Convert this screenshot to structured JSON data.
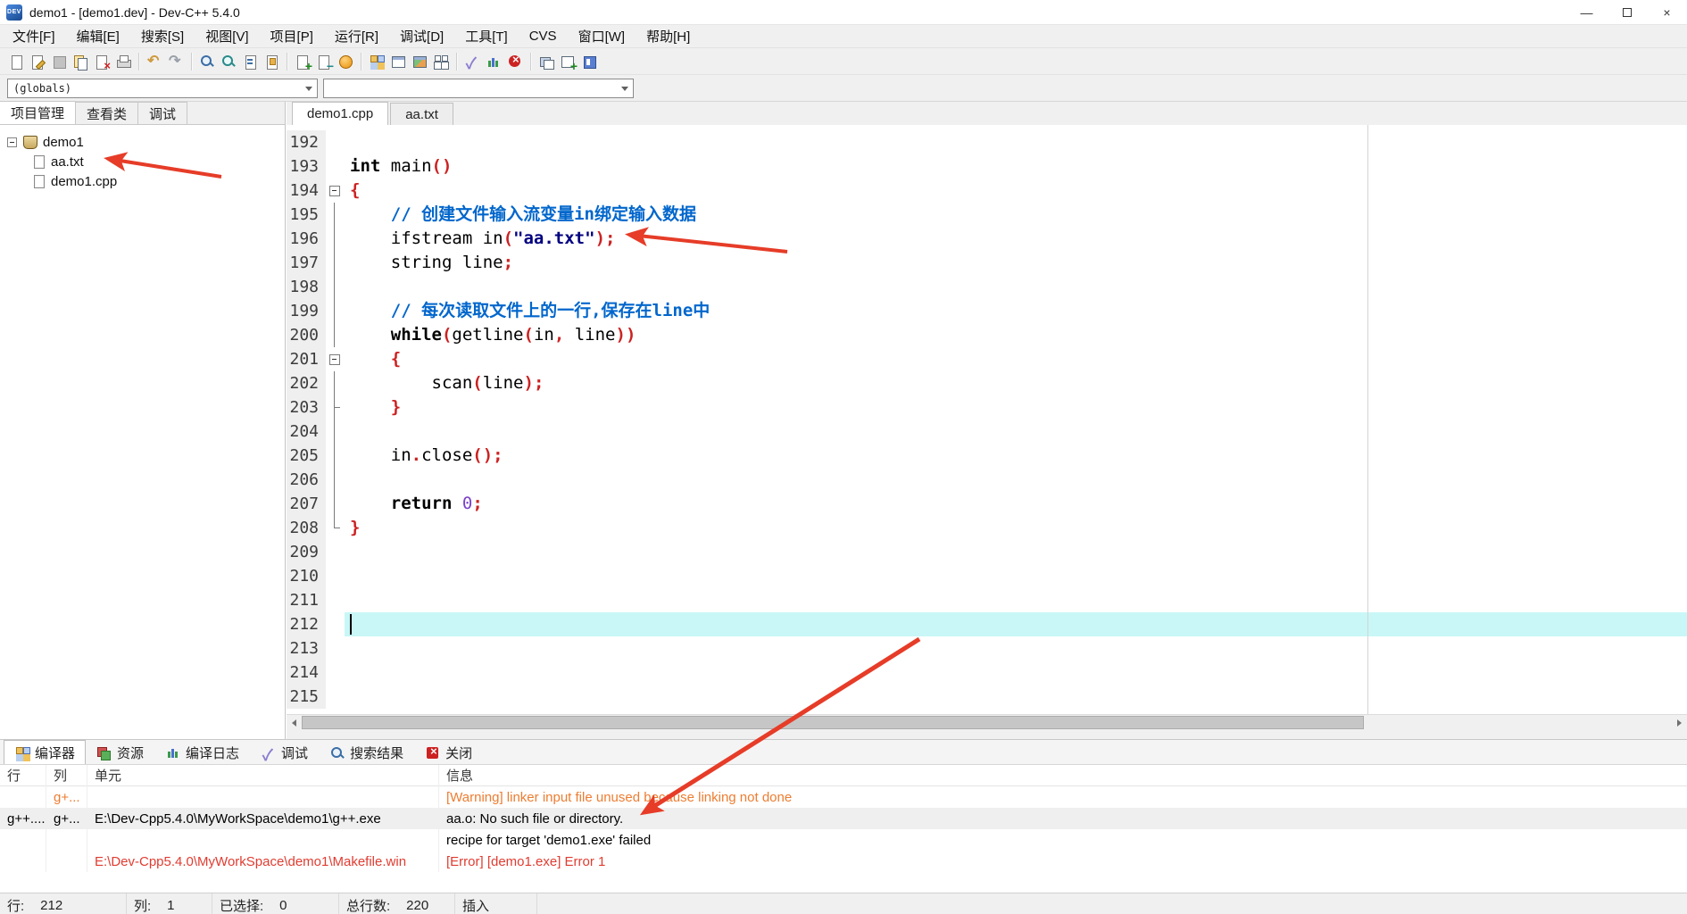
{
  "window": {
    "title": "demo1 - [demo1.dev] - Dev-C++ 5.4.0",
    "app_icon_label": "DEV",
    "controls": {
      "minimize": "—",
      "restore": "",
      "close": "×"
    }
  },
  "menu": {
    "items": [
      "文件[F]",
      "编辑[E]",
      "搜索[S]",
      "视图[V]",
      "项目[P]",
      "运行[R]",
      "调试[D]",
      "工具[T]",
      "CVS",
      "窗口[W]",
      "帮助[H]"
    ]
  },
  "toolbar": {
    "groups": [
      [
        "new-file-icon",
        "open-icon",
        "save-icon",
        "save-all-icon",
        "close-file-icon",
        "print-icon"
      ],
      [
        "undo-icon",
        "redo-icon"
      ],
      [
        "find-icon",
        "find-in-files-icon",
        "replace-icon",
        "goto-line-icon"
      ],
      [
        "add-to-project-icon",
        "remove-from-project-icon",
        "project-options-icon"
      ],
      [
        "compile-icon",
        "run-icon",
        "compile-and-run-icon",
        "rebuild-all-icon"
      ],
      [
        "debug-icon",
        "profile-icon",
        "abort-compilation-icon"
      ],
      [
        "window-list-icon",
        "new-window-icon",
        "fullscreen-icon"
      ]
    ]
  },
  "class_browser": {
    "selected": "(globals)"
  },
  "left_panel": {
    "tabs": [
      "项目管理",
      "查看类",
      "调试"
    ],
    "active_tab": "项目管理",
    "tree": {
      "root": "demo1",
      "children": [
        "aa.txt",
        "demo1.cpp"
      ]
    }
  },
  "editor": {
    "tabs": [
      "demo1.cpp",
      "aa.txt"
    ],
    "active_tab": "demo1.cpp",
    "cursor_line": 212,
    "lines": [
      {
        "no": 192,
        "fold": "",
        "segs": []
      },
      {
        "no": 193,
        "fold": "",
        "segs": [
          {
            "c": "kw",
            "t": "int"
          },
          {
            "c": "id",
            "t": " main"
          },
          {
            "c": "sym",
            "t": "()"
          }
        ]
      },
      {
        "no": 194,
        "fold": "box",
        "segs": [
          {
            "c": "sym",
            "t": "{"
          }
        ]
      },
      {
        "no": 195,
        "fold": "line",
        "segs": [
          {
            "c": "id",
            "t": "    "
          },
          {
            "c": "com",
            "t": "// 创建文件输入流变量in绑定输入数据"
          }
        ]
      },
      {
        "no": 196,
        "fold": "line",
        "segs": [
          {
            "c": "id",
            "t": "    ifstream in"
          },
          {
            "c": "sym",
            "t": "("
          },
          {
            "c": "str",
            "t": "\"aa.txt\""
          },
          {
            "c": "sym",
            "t": ");"
          }
        ]
      },
      {
        "no": 197,
        "fold": "line",
        "segs": [
          {
            "c": "id",
            "t": "    string line"
          },
          {
            "c": "sym",
            "t": ";"
          }
        ]
      },
      {
        "no": 198,
        "fold": "line",
        "segs": []
      },
      {
        "no": 199,
        "fold": "line",
        "segs": [
          {
            "c": "id",
            "t": "    "
          },
          {
            "c": "com",
            "t": "// 每次读取文件上的一行,保存在line中"
          }
        ]
      },
      {
        "no": 200,
        "fold": "line",
        "segs": [
          {
            "c": "id",
            "t": "    "
          },
          {
            "c": "kw",
            "t": "while"
          },
          {
            "c": "sym",
            "t": "("
          },
          {
            "c": "id",
            "t": "getline"
          },
          {
            "c": "sym",
            "t": "("
          },
          {
            "c": "id",
            "t": "in"
          },
          {
            "c": "sym",
            "t": ","
          },
          {
            "c": "id",
            "t": " line"
          },
          {
            "c": "sym",
            "t": "))"
          }
        ]
      },
      {
        "no": 201,
        "fold": "box",
        "segs": [
          {
            "c": "id",
            "t": "    "
          },
          {
            "c": "sym",
            "t": "{"
          }
        ]
      },
      {
        "no": 202,
        "fold": "line",
        "segs": [
          {
            "c": "id",
            "t": "        scan"
          },
          {
            "c": "sym",
            "t": "("
          },
          {
            "c": "id",
            "t": "line"
          },
          {
            "c": "sym",
            "t": ");"
          }
        ]
      },
      {
        "no": 203,
        "fold": "endline",
        "segs": [
          {
            "c": "id",
            "t": "    "
          },
          {
            "c": "sym",
            "t": "}"
          }
        ]
      },
      {
        "no": 204,
        "fold": "line",
        "segs": []
      },
      {
        "no": 205,
        "fold": "line",
        "segs": [
          {
            "c": "id",
            "t": "    in"
          },
          {
            "c": "sym",
            "t": "."
          },
          {
            "c": "id",
            "t": "close"
          },
          {
            "c": "sym",
            "t": "();"
          }
        ]
      },
      {
        "no": 206,
        "fold": "line",
        "segs": []
      },
      {
        "no": 207,
        "fold": "line",
        "segs": [
          {
            "c": "id",
            "t": "    "
          },
          {
            "c": "kw",
            "t": "return"
          },
          {
            "c": "id",
            "t": " "
          },
          {
            "c": "num",
            "t": "0"
          },
          {
            "c": "sym",
            "t": ";"
          }
        ]
      },
      {
        "no": 208,
        "fold": "end",
        "segs": [
          {
            "c": "sym",
            "t": "}"
          }
        ]
      },
      {
        "no": 209,
        "fold": "",
        "segs": []
      },
      {
        "no": 210,
        "fold": "",
        "segs": []
      },
      {
        "no": 211,
        "fold": "",
        "segs": []
      },
      {
        "no": 212,
        "fold": "",
        "segs": []
      },
      {
        "no": 213,
        "fold": "",
        "segs": []
      },
      {
        "no": 214,
        "fold": "",
        "segs": []
      },
      {
        "no": 215,
        "fold": "",
        "segs": []
      }
    ]
  },
  "bottom_panel": {
    "tabs": [
      {
        "label": "编译器"
      },
      {
        "label": "资源"
      },
      {
        "label": "编译日志"
      },
      {
        "label": "调试"
      },
      {
        "label": "搜索结果"
      },
      {
        "label": "关闭"
      }
    ],
    "active_tab": "编译器",
    "columns": [
      "行",
      "列",
      "单元",
      "信息"
    ],
    "rows": [
      {
        "line": "",
        "col": "g+...",
        "unit": "",
        "message": "[Warning] linker input file unused because linking not done",
        "style": "warning"
      },
      {
        "line": "g++....",
        "col": "g+...",
        "unit": "E:\\Dev-Cpp5.4.0\\MyWorkSpace\\demo1\\g++.exe",
        "message": "aa.o: No such file or directory.",
        "style": "selected"
      },
      {
        "line": "",
        "col": "",
        "unit": "",
        "message": "recipe for target 'demo1.exe' failed",
        "style": "plain"
      },
      {
        "line": "",
        "col": "",
        "unit": "E:\\Dev-Cpp5.4.0\\MyWorkSpace\\demo1\\Makefile.win",
        "message": "[Error] [demo1.exe] Error 1",
        "style": "error"
      }
    ]
  },
  "status_bar": {
    "fields": [
      {
        "label": "行:",
        "value": "212"
      },
      {
        "label": "列:",
        "value": "1"
      },
      {
        "label": "已选择:",
        "value": "0"
      },
      {
        "label": "总行数:",
        "value": "220"
      },
      {
        "label": "插入",
        "value": ""
      }
    ]
  },
  "colors": {
    "arrow": "#e63c28",
    "warning": "#ed7d31",
    "error": "#e03c31",
    "current_line": "#c9f7f7",
    "comment": "#0066cc",
    "string": "#000080",
    "symbol": "#cc2222",
    "number": "#7c41c8"
  }
}
